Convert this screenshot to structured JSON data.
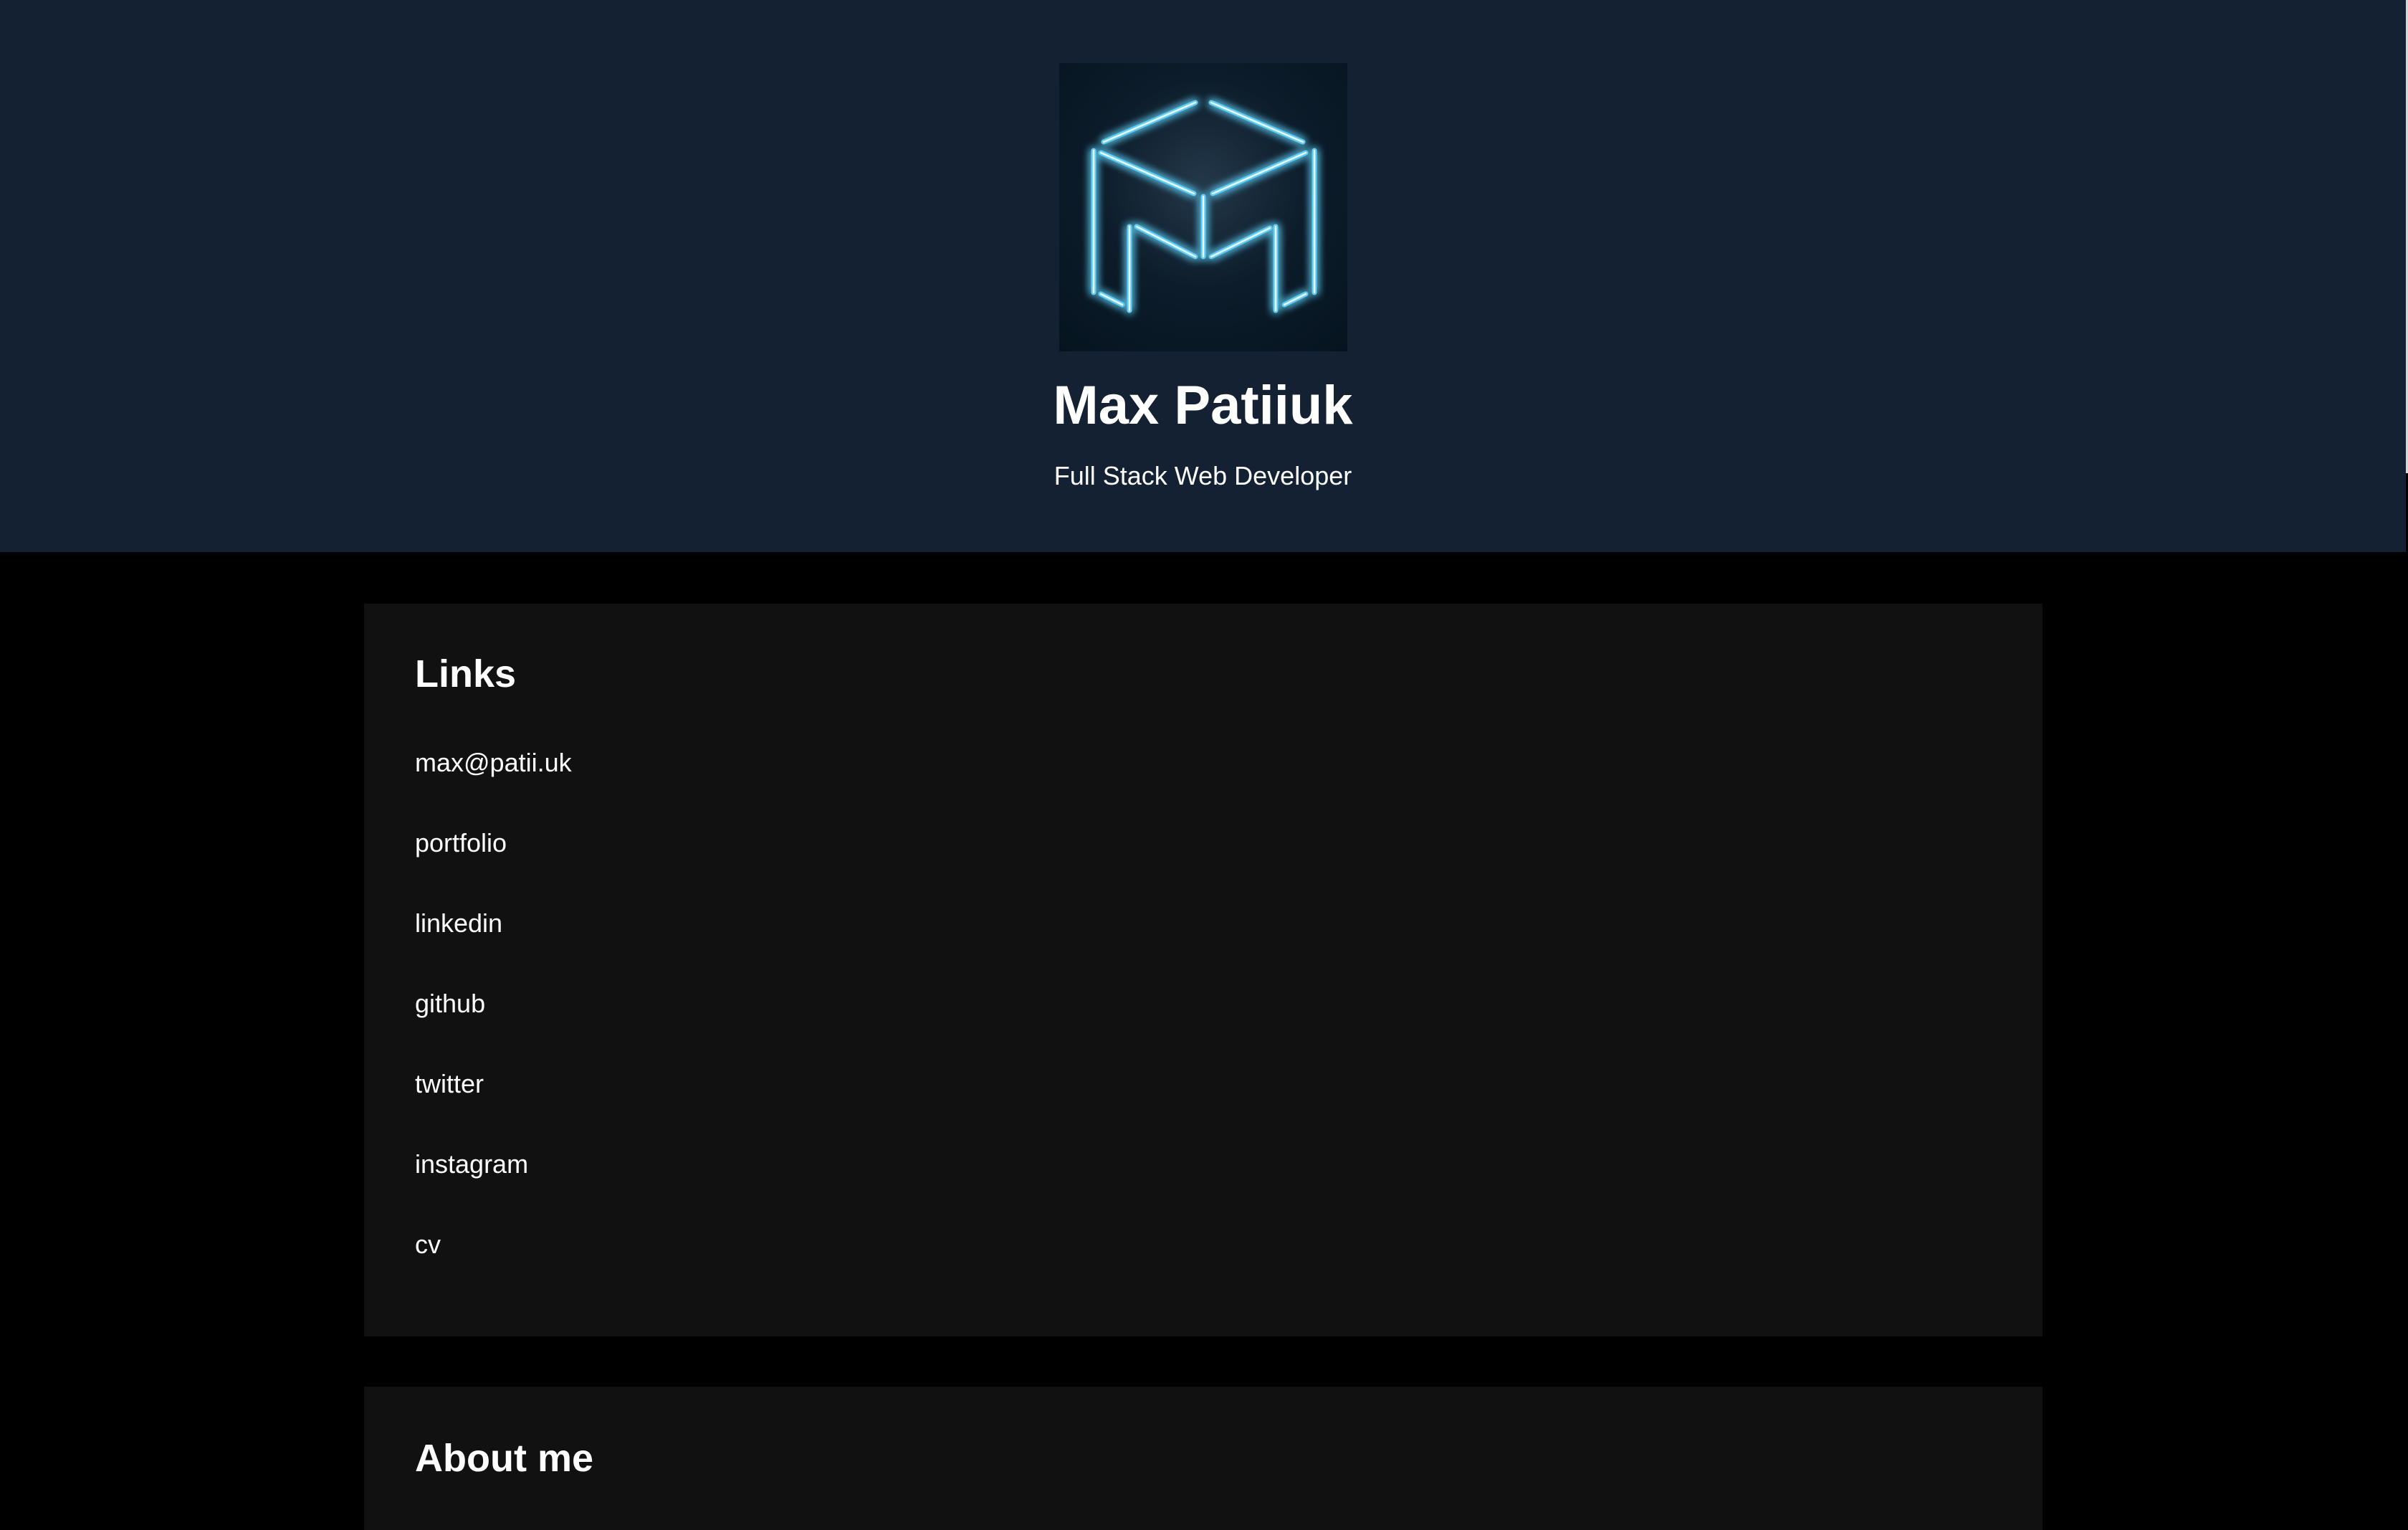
{
  "profile": {
    "name": "Max Patiiuk",
    "tagline": "Full Stack Web Developer",
    "logo_icon": "neon-m-cube-logo",
    "logo_color": "#4cc3f0"
  },
  "links_section": {
    "title": "Links",
    "items": [
      {
        "label": "max@patii.uk"
      },
      {
        "label": "portfolio"
      },
      {
        "label": "linkedin"
      },
      {
        "label": "github"
      },
      {
        "label": "twitter"
      },
      {
        "label": "instagram"
      },
      {
        "label": "cv"
      }
    ]
  },
  "about_section": {
    "title": "About me"
  },
  "colors": {
    "header_bg": "#132132",
    "page_bg": "#000000",
    "card_bg": "#111111",
    "text": "#ffffff"
  }
}
